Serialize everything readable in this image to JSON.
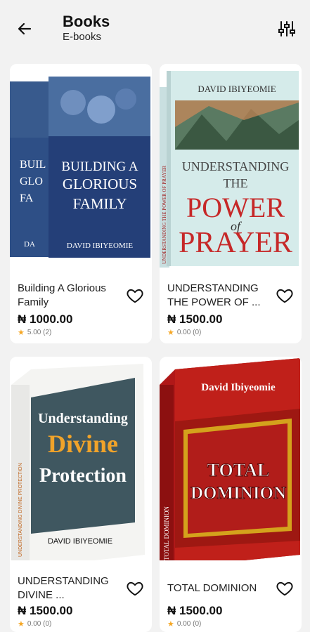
{
  "header": {
    "title": "Books",
    "subtitle": "E-books",
    "back_icon": "arrow-left-icon",
    "filter_icon": "sliders-icon"
  },
  "products": [
    {
      "name": "Building A Glorious Family",
      "price": "₦ 1000.00",
      "rating": "5.00 (2)",
      "cover": {
        "line1": "BUILDING A",
        "line2": "GLORIOUS",
        "line3": "FAMILY",
        "author": "DAVID IBIYEOMIE"
      }
    },
    {
      "name": "UNDERSTANDING THE POWER OF ...",
      "price": "₦ 1500.00",
      "rating": "0.00 (0)",
      "cover": {
        "author": "DAVID IBIYEOMIE",
        "line1": "UNDERSTANDING",
        "line2": "THE",
        "line3": "POWER",
        "line4": "of",
        "line5": "PRAYER",
        "spine": "UNDERSTANDING THE POWER OF PRAYER"
      }
    },
    {
      "name": "UNDERSTANDING DIVINE ...",
      "price": "₦ 1500.00",
      "rating": "0.00 (0)",
      "cover": {
        "line1": "Understanding",
        "line2": "Divine",
        "line3": "Protection",
        "author": "DAVID IBIYEOMIE",
        "spine": "UNDERSTANDING DIVINE PROTECTION"
      }
    },
    {
      "name": "TOTAL DOMINION",
      "price": "₦ 1500.00",
      "rating": "0.00 (0)",
      "cover": {
        "author": "David Ibiyeomie",
        "line1": "TOTAL",
        "line2": "DOMINION",
        "spine": "TOTAL DOMINION"
      }
    }
  ],
  "colors": {
    "price": "#111111",
    "star": "#f5a623",
    "card": "#ffffff",
    "background": "#f2f2f2"
  }
}
